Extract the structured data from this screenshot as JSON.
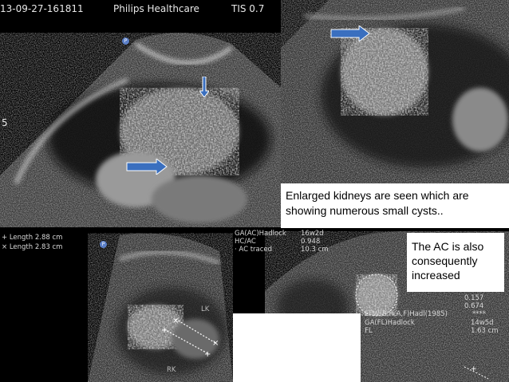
{
  "top_left": {
    "header_id": "13-09-27-161811",
    "header_vendor": "Philips Healthcare",
    "header_tis": "TIS 0.7",
    "depth_mark": "5",
    "p_marker": "P"
  },
  "bottom_left": {
    "measure1": "+ Length   2.88 cm",
    "measure2": "× Length   2.83 cm",
    "p_marker": "P",
    "label_lk": "LK",
    "label_rk": "RK"
  },
  "bottom_right": {
    "row1_left": "GA(AC)Hadlock",
    "row1_right": "16w2d",
    "row2_left": "HC/AC",
    "row2_right": "0.948",
    "row3_left": "· AC traced",
    "row3_right": "10.3 cm",
    "val1": "0.157",
    "val2": "0.674",
    "val3": "****",
    "efw": "EFW(B,H,A,F)Hadl(1985)",
    "ga_fl_left": "GA(FL)Hadlock",
    "ga_fl_right": "14w5d",
    "fl_left": "FL",
    "fl_right": "1.63 cm"
  },
  "captions": {
    "kidneys": "Enlarged kidneys are seen which are showing numerous small cysts..",
    "ac": "The AC is also consequently increased"
  },
  "colors": {
    "arrow_fill": "#3a6fbf",
    "caption_bg": "#ffffff"
  }
}
